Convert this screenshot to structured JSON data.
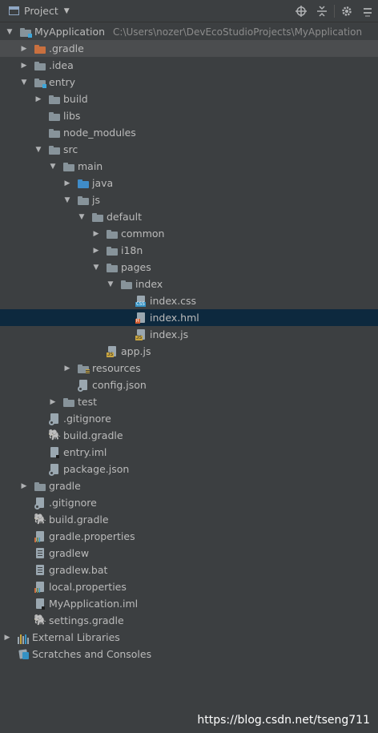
{
  "header": {
    "title": "Project",
    "dropdown_icon": "chevron-down-icon",
    "tools": [
      "locate-icon",
      "collapse-all-icon",
      "settings-icon",
      "hide-icon"
    ]
  },
  "tree": {
    "rows": [
      {
        "label": "MyApplication",
        "path": "C:\\Users\\nozer\\DevEcoStudioProjects\\MyApplication",
        "arrow": "expanded",
        "icon": "module-folder"
      },
      {
        "label": ".gradle",
        "arrow": "collapsed",
        "icon": "folder-orange"
      },
      {
        "label": ".idea",
        "arrow": "collapsed",
        "icon": "folder"
      },
      {
        "label": "entry",
        "arrow": "expanded",
        "icon": "module-folder"
      },
      {
        "label": "build",
        "arrow": "collapsed",
        "icon": "folder"
      },
      {
        "label": "libs",
        "arrow": "none",
        "icon": "folder"
      },
      {
        "label": "node_modules",
        "arrow": "none",
        "icon": "folder"
      },
      {
        "label": "src",
        "arrow": "expanded",
        "icon": "folder"
      },
      {
        "label": "main",
        "arrow": "expanded",
        "icon": "folder"
      },
      {
        "label": "java",
        "arrow": "collapsed",
        "icon": "folder-blue"
      },
      {
        "label": "js",
        "arrow": "expanded",
        "icon": "folder"
      },
      {
        "label": "default",
        "arrow": "expanded",
        "icon": "folder"
      },
      {
        "label": "common",
        "arrow": "collapsed",
        "icon": "folder"
      },
      {
        "label": "i18n",
        "arrow": "collapsed",
        "icon": "folder"
      },
      {
        "label": "pages",
        "arrow": "expanded",
        "icon": "folder"
      },
      {
        "label": "index",
        "arrow": "expanded",
        "icon": "folder"
      },
      {
        "label": "index.css",
        "arrow": "none",
        "icon": "css-file"
      },
      {
        "label": "index.hml",
        "arrow": "none",
        "icon": "hml-file"
      },
      {
        "label": "index.js",
        "arrow": "none",
        "icon": "js-file"
      },
      {
        "label": "app.js",
        "arrow": "none",
        "icon": "js-file"
      },
      {
        "label": "resources",
        "arrow": "collapsed",
        "icon": "resources-folder"
      },
      {
        "label": "config.json",
        "arrow": "none",
        "icon": "config-file"
      },
      {
        "label": "test",
        "arrow": "collapsed",
        "icon": "folder"
      },
      {
        "label": ".gitignore",
        "arrow": "none",
        "icon": "config-file"
      },
      {
        "label": "build.gradle",
        "arrow": "none",
        "icon": "gradle-icon"
      },
      {
        "label": "entry.iml",
        "arrow": "none",
        "icon": "iml-file"
      },
      {
        "label": "package.json",
        "arrow": "none",
        "icon": "config-file"
      },
      {
        "label": "gradle",
        "arrow": "collapsed",
        "icon": "folder"
      },
      {
        "label": ".gitignore",
        "arrow": "none",
        "icon": "config-file"
      },
      {
        "label": "build.gradle",
        "arrow": "none",
        "icon": "gradle-icon"
      },
      {
        "label": "gradle.properties",
        "arrow": "none",
        "icon": "properties-file"
      },
      {
        "label": "gradlew",
        "arrow": "none",
        "icon": "text-file"
      },
      {
        "label": "gradlew.bat",
        "arrow": "none",
        "icon": "text-file"
      },
      {
        "label": "local.properties",
        "arrow": "none",
        "icon": "properties-file"
      },
      {
        "label": "MyApplication.iml",
        "arrow": "none",
        "icon": "iml-file"
      },
      {
        "label": "settings.gradle",
        "arrow": "none",
        "icon": "gradle-icon"
      },
      {
        "label": "External Libraries",
        "arrow": "collapsed",
        "icon": "libraries-icon"
      },
      {
        "label": "Scratches and Consoles",
        "arrow": "none",
        "icon": "scratches-icon"
      }
    ],
    "selected_label": "index.hml",
    "highlighted_label": ".gradle"
  },
  "watermark": "https://blog.csdn.net/tseng711",
  "colors": {
    "background": "#3c3f41",
    "selection": "#0d293e",
    "hover": "#4b4d4f",
    "text": "#bbbbbb"
  }
}
